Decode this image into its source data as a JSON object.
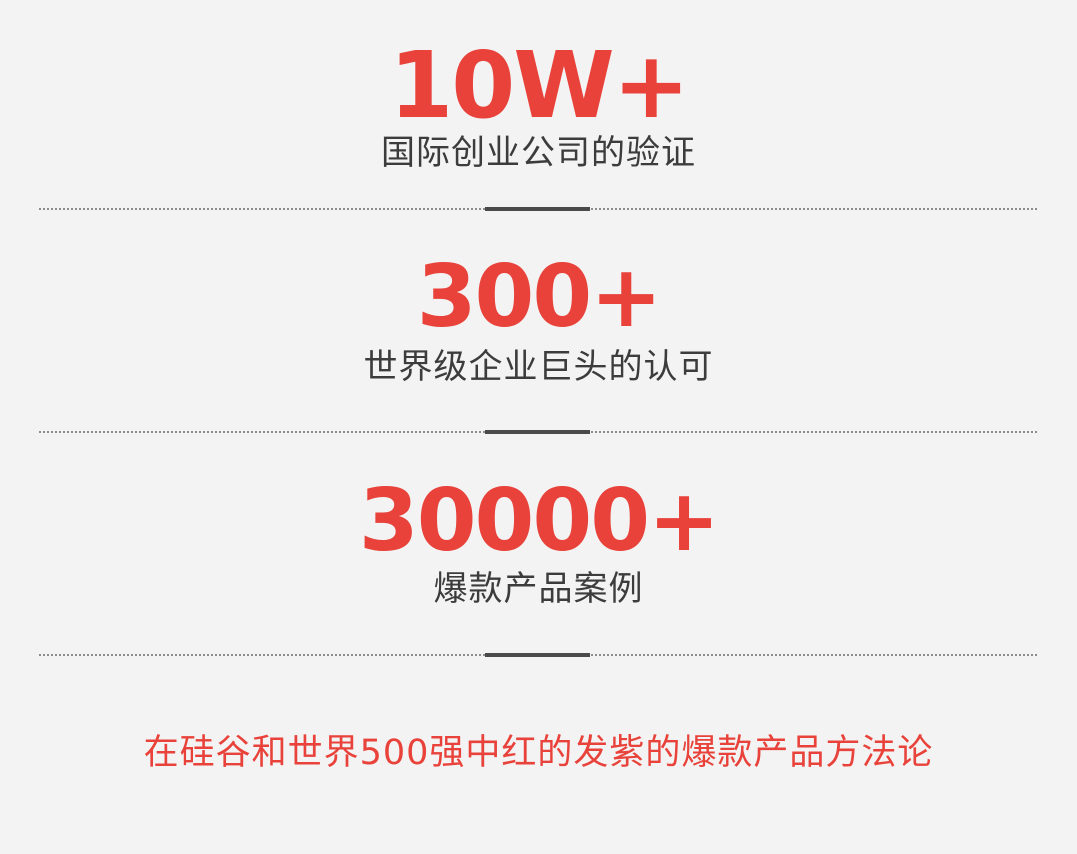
{
  "stats": [
    {
      "number": "10W+",
      "label": "国际创业公司的验证"
    },
    {
      "number": "300+",
      "label": "世界级企业巨头的认可"
    },
    {
      "number": "30000+",
      "label": "爆款产品案例"
    }
  ],
  "tagline": "在硅谷和世界500强中红的发紫的爆款产品方法论",
  "colors": {
    "accent": "#e8423a",
    "text": "#3c3c3c",
    "background": "#f3f3f3",
    "divider": "#4a4a4a"
  }
}
